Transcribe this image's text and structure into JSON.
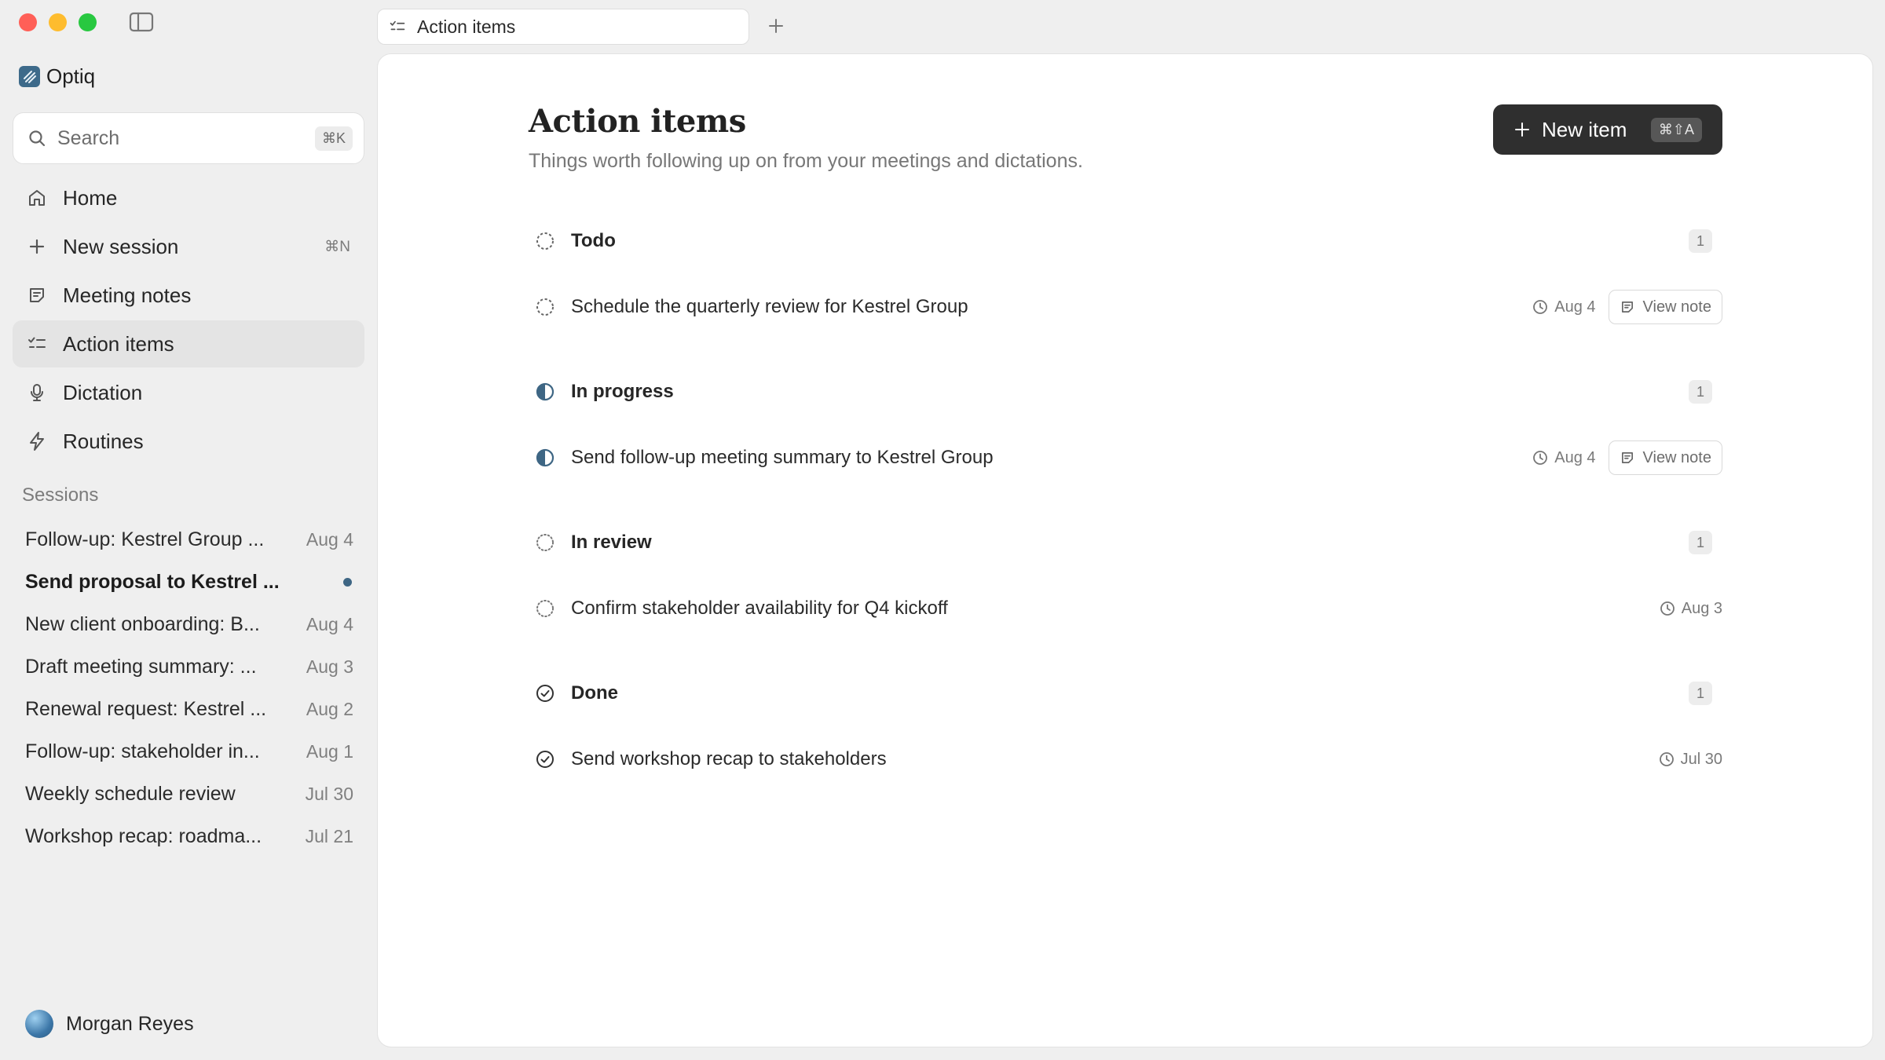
{
  "app": {
    "name": "Optiq"
  },
  "window": {
    "traffic": {
      "close": "#ff5f57",
      "minimize": "#febc2e",
      "zoom": "#28c840"
    }
  },
  "search": {
    "placeholder": "Search",
    "shortcut": "⌘K"
  },
  "nav": {
    "home": {
      "label": "Home"
    },
    "new_session": {
      "label": "New session",
      "shortcut": "⌘N"
    },
    "meeting_notes": {
      "label": "Meeting notes"
    },
    "action_items": {
      "label": "Action items"
    },
    "dictation": {
      "label": "Dictation"
    },
    "routines": {
      "label": "Routines"
    }
  },
  "sessions": {
    "heading": "Sessions",
    "items": [
      {
        "title": "Follow-up: Kestrel Group ...",
        "date": "Aug 4"
      },
      {
        "title": "Send proposal to Kestrel ...",
        "date": ""
      },
      {
        "title": "New client onboarding: B...",
        "date": "Aug 4"
      },
      {
        "title": "Draft meeting summary: ...",
        "date": "Aug 3"
      },
      {
        "title": "Renewal request: Kestrel ...",
        "date": "Aug 2"
      },
      {
        "title": "Follow-up: stakeholder in...",
        "date": "Aug 1"
      },
      {
        "title": "Weekly schedule review",
        "date": "Jul 30"
      },
      {
        "title": "Workshop recap: roadma...",
        "date": "Jul 21"
      }
    ]
  },
  "user": {
    "name": "Morgan Reyes"
  },
  "tab": {
    "label": "Action items"
  },
  "page": {
    "title": "Action items",
    "subtitle": "Things worth following up on from your meetings and dictations.",
    "new_button": {
      "label": "New item",
      "shortcut": "⌘⇧A"
    }
  },
  "groups": {
    "todo": {
      "title": "Todo",
      "count": "1",
      "item": {
        "title": "Schedule the quarterly review for Kestrel Group",
        "date": "Aug 4",
        "view_note": "View note"
      }
    },
    "in_progress": {
      "title": "In progress",
      "count": "1",
      "item": {
        "title": "Send follow-up meeting summary to Kestrel Group",
        "date": "Aug 4",
        "view_note": "View note"
      }
    },
    "in_review": {
      "title": "In review",
      "count": "1",
      "item": {
        "title": "Confirm stakeholder availability for Q4 kickoff",
        "date": "Aug 3"
      }
    },
    "done": {
      "title": "Done",
      "count": "1",
      "item": {
        "title": "Send workshop recap to stakeholders",
        "date": "Jul 30"
      }
    }
  },
  "colors": {
    "accent": "#3e6684",
    "button_dark": "#2f2f2f"
  },
  "icons": {
    "todo": "dashed-circle-icon",
    "in_progress": "half-circle-icon",
    "in_review": "dotted-circle-icon",
    "done": "check-circle-icon"
  }
}
